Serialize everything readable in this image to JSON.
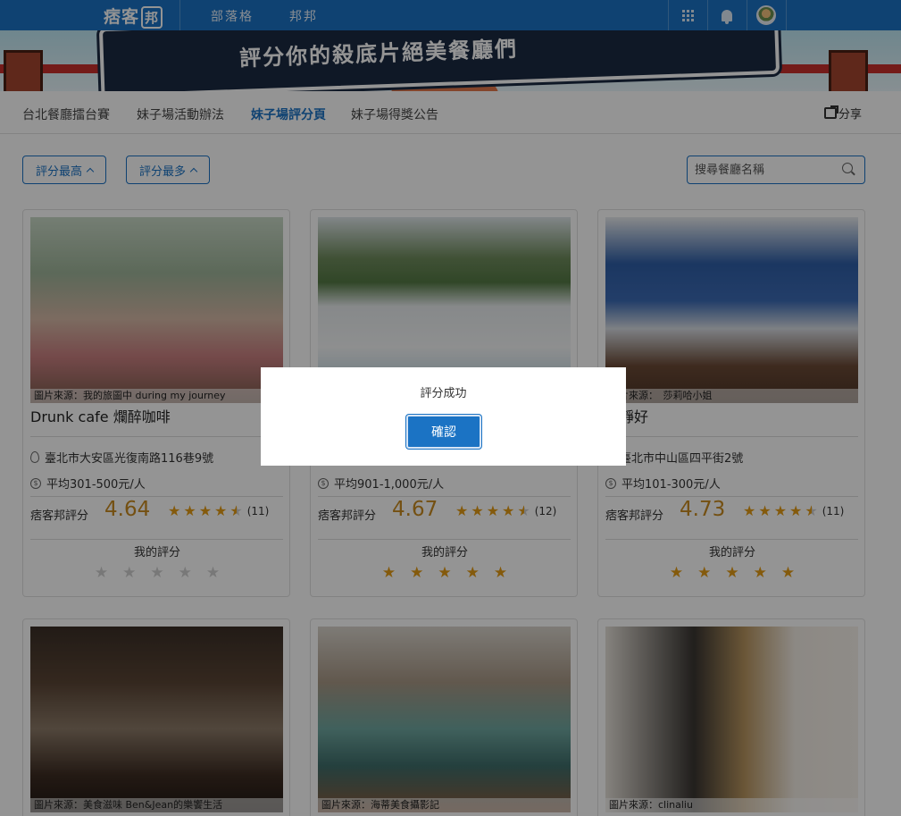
{
  "header": {
    "logo_text": "痞客",
    "logo_box": "邦",
    "nav": [
      "部落格",
      "邦邦"
    ],
    "icons": [
      "apps-grid-icon",
      "bell-icon",
      "avatar"
    ]
  },
  "banner": {
    "title": "評分你的殺底片絕美餐廳們"
  },
  "tabs": {
    "items": [
      "台北餐廳擂台賽",
      "妹子場活動辦法",
      "妹子場評分頁",
      "妹子場得獎公告"
    ],
    "active_index": 2,
    "share_label": "分享"
  },
  "filters": {
    "sort_top": "評分最高",
    "sort_most": "評分最多",
    "search_placeholder": "搜尋餐廳名稱"
  },
  "cards": [
    {
      "credit": "圖片來源：我的旅圖中 during my journey",
      "name": "Drunk cafe 爛醉咖啡",
      "address": "臺北市大安區光復南路116巷9號",
      "price": "平均301-500元/人",
      "rating_label": "痞客邦評分",
      "rating": "4.64",
      "count": "(11)",
      "my_label": "我的評分",
      "my_rating": 0
    },
    {
      "credit": "",
      "name": "",
      "address": "",
      "price": "平均901-1,000元/人",
      "rating_label": "痞客邦評分",
      "rating": "4.67",
      "count": "(12)",
      "my_label": "我的評分",
      "my_rating": 5
    },
    {
      "credit": "圖片來源：　莎莉哈小姐",
      "name": "安靜好",
      "address": "臺北市中山區四平街2號",
      "price": "平均101-300元/人",
      "rating_label": "痞客邦評分",
      "rating": "4.73",
      "count": "(11)",
      "my_label": "我的評分",
      "my_rating": 5
    },
    {
      "credit": "圖片來源：美食滋味 Ben&Jean的樂饗生活"
    },
    {
      "credit": "圖片來源：海蒂美食攝影記"
    },
    {
      "credit": "圖片來源：clinaliu"
    }
  ],
  "modal": {
    "message": "評分成功",
    "confirm_label": "確認"
  },
  "colors": {
    "brand": "#1b73c4",
    "star": "#e39b15",
    "rating_text": "#c88a1f"
  }
}
